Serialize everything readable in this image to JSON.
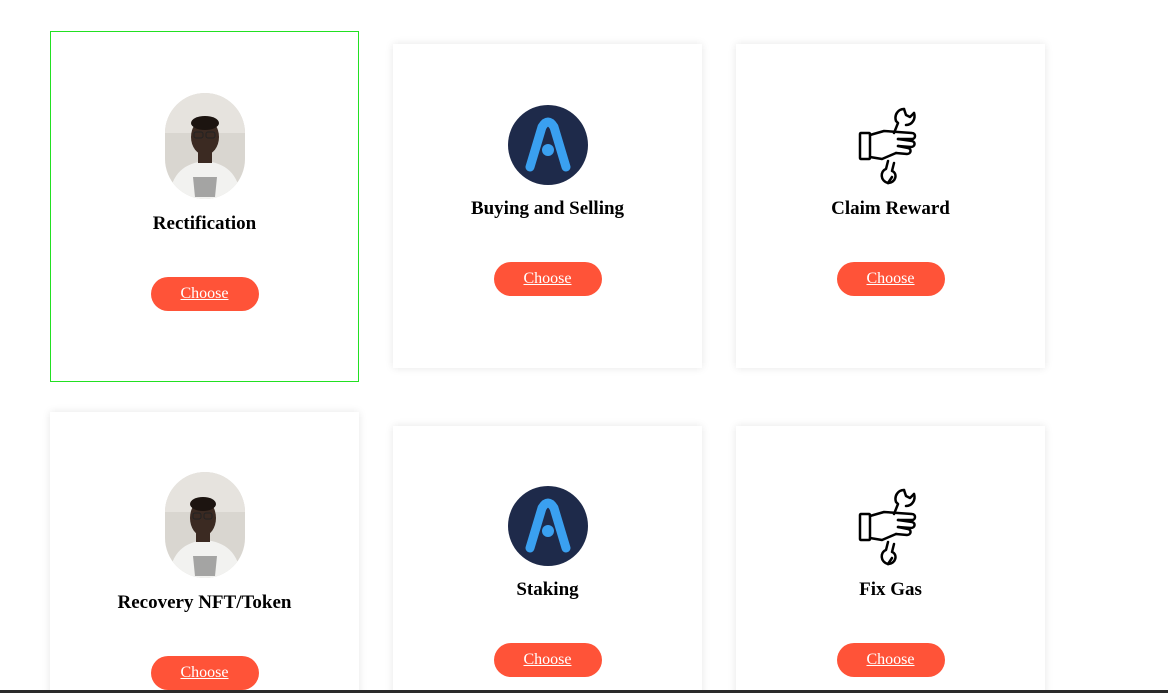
{
  "cards": [
    {
      "title": "Rectification",
      "button": "Choose",
      "icon": "person-photo-avatar",
      "selected": true
    },
    {
      "title": "Buying and Selling",
      "button": "Choose",
      "icon": "arch-logo-icon"
    },
    {
      "title": "Claim Reward",
      "button": "Choose",
      "icon": "hand-wrench-icon"
    },
    {
      "title": "Recovery NFT/Token",
      "button": "Choose",
      "icon": "person-photo-avatar"
    },
    {
      "title": "Staking",
      "button": "Choose",
      "icon": "arch-logo-icon"
    },
    {
      "title": "Fix Gas",
      "button": "Choose",
      "icon": "hand-wrench-icon"
    }
  ],
  "colors": {
    "button": "#ff5338",
    "selected_border": "#22e022",
    "logo_bg": "#1e2a4a",
    "logo_accent": "#3aa0f0"
  }
}
